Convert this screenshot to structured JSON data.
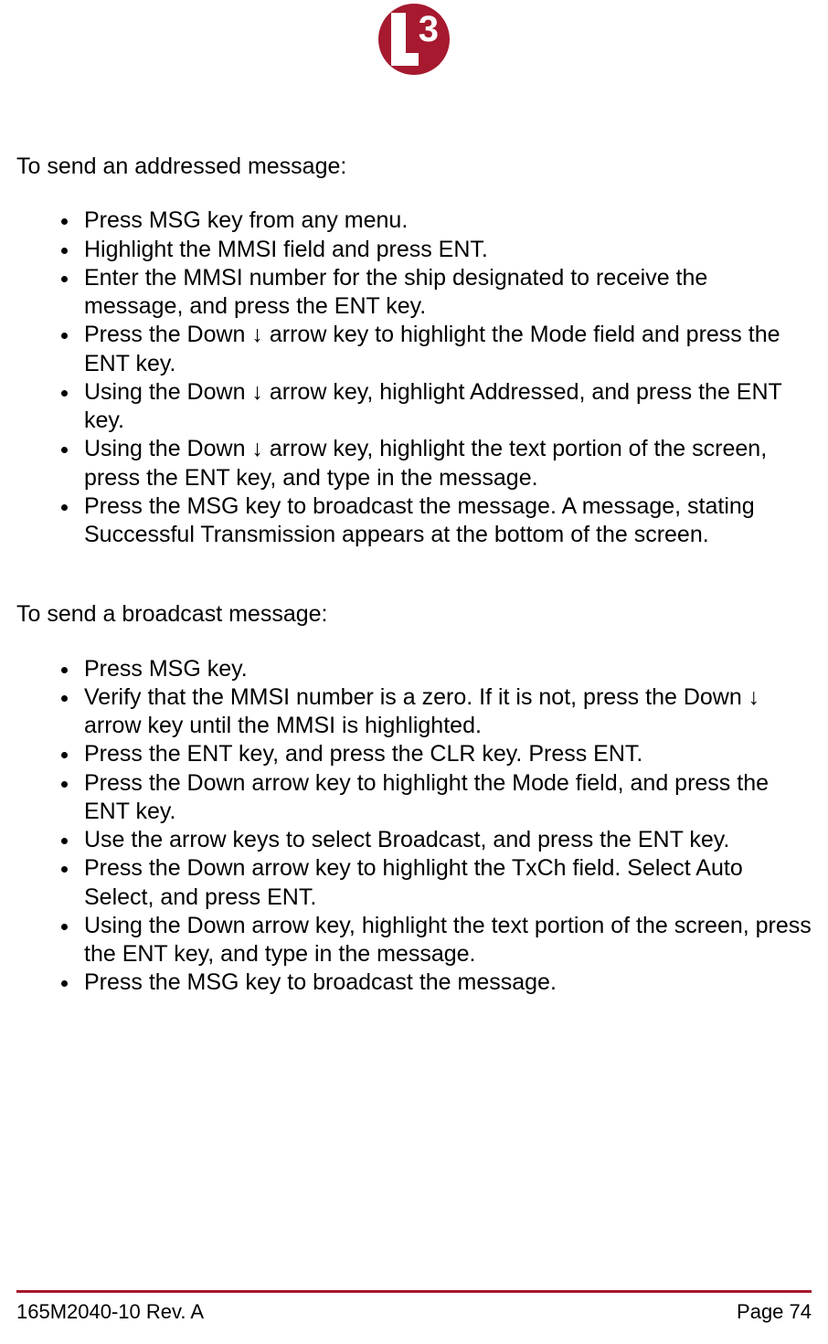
{
  "logo": {
    "letter": "L",
    "digit": "3"
  },
  "section1": {
    "intro": "To send an addressed message:",
    "items": [
      "Press MSG key from any menu.",
      "Highlight the MMSI field and press ENT.",
      "Enter the MMSI number for the ship designated to receive the message, and press the ENT key.",
      "Press the Down ↓ arrow key to highlight the Mode field and press the ENT key.",
      "Using the Down ↓ arrow key, highlight Addressed, and press the ENT key.",
      "Using the Down ↓ arrow key, highlight the text portion of the screen, press the ENT key, and type in the message.",
      "Press the MSG key to broadcast the message. A message, stating Successful Transmission appears at the bottom of the screen."
    ]
  },
  "section2": {
    "intro": "To send a broadcast message:",
    "items": [
      "Press MSG key.",
      "Verify that the MMSI number is a zero. If it is not, press the Down ↓ arrow key until the MMSI is highlighted.",
      "Press the ENT key, and press the CLR key. Press ENT.",
      "Press the Down arrow key to highlight the Mode field, and press the ENT key.",
      "Use the arrow keys to select Broadcast, and press the ENT key.",
      "Press the Down arrow key to highlight the TxCh field. Select Auto Select, and press ENT.",
      "Using the Down arrow key, highlight the text portion of the screen, press the ENT key, and type in the message.",
      "Press the MSG key to broadcast the message."
    ]
  },
  "footer": {
    "doc_id": "165M2040-10 Rev. A",
    "page": "Page 74"
  }
}
